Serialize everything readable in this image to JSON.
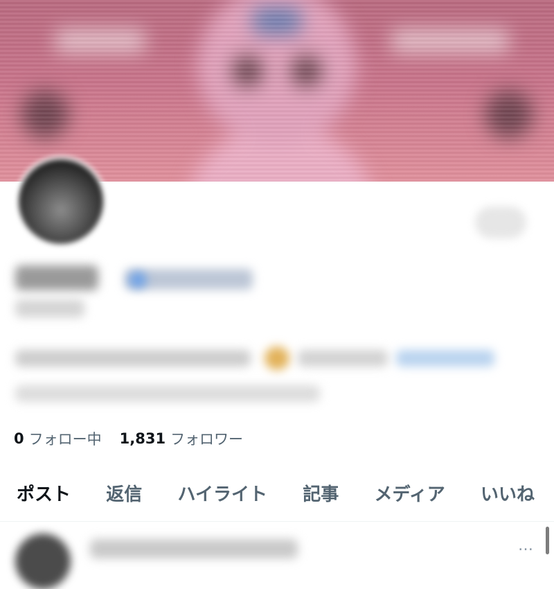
{
  "profile": {
    "following_count": "0",
    "following_label": "フォロー中",
    "followers_count": "1,831",
    "followers_label": "フォロワー"
  },
  "tabs": [
    {
      "label": "ポスト",
      "active": true
    },
    {
      "label": "返信",
      "active": false
    },
    {
      "label": "ハイライト",
      "active": false
    },
    {
      "label": "記事",
      "active": false
    },
    {
      "label": "メディア",
      "active": false
    },
    {
      "label": "いいね",
      "active": false
    }
  ],
  "post": {
    "more_icon": "…"
  },
  "colors": {
    "banner_top": "#b96a80",
    "banner_bottom": "#e0909c",
    "text_primary": "#0f1419",
    "text_secondary": "#536471",
    "link_blue": "#6fa2e6"
  },
  "icons": {
    "more": "more-icon"
  }
}
